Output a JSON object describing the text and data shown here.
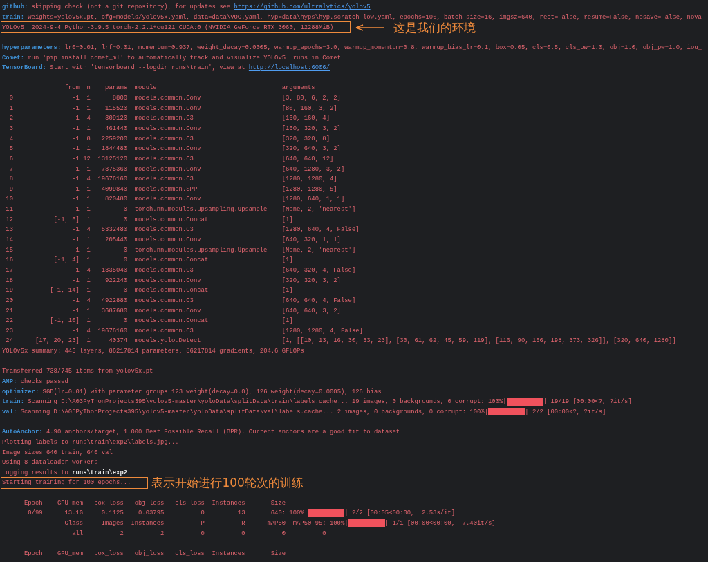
{
  "lines": [
    {
      "kind": "log",
      "segments": [
        {
          "kind": "label",
          "text": "github:"
        },
        {
          "kind": "text",
          "text": "skipping check (not a git repository), for updates see "
        },
        {
          "kind": "link",
          "text": "https://github.com/ultralytics/yolov5"
        }
      ]
    },
    {
      "kind": "log",
      "segments": [
        {
          "kind": "label",
          "text": "train:"
        },
        {
          "kind": "text",
          "text": "weights=yolov5x.pt, cfg=models/yolov5x.yaml, data=data\\VOC.yaml, hyp=data\\hyps\\hyp.scratch-low.yaml, epochs=100, batch_size=16, imgsz=640, rect=False, resume=False, nosave=False, nova"
        }
      ]
    },
    {
      "kind": "log",
      "boxed": true,
      "note": {
        "text": "这是我们的环境",
        "arrow": true
      },
      "segments": [
        {
          "kind": "text",
          "text": "YOLOv5  2024-9-4 Python-3.9.5 torch-2.2.1+cu121 CUDA:0 (NVIDIA GeForce RTX 3060, 12288MiB)"
        }
      ]
    },
    {
      "kind": "blank"
    },
    {
      "kind": "log",
      "segments": [
        {
          "kind": "label",
          "text": "hyperparameters:"
        },
        {
          "kind": "text",
          "text": "lr0=0.01, lrf=0.01, momentum=0.937, weight_decay=0.0005, warmup_epochs=3.0, warmup_momentum=0.8, warmup_bias_lr=0.1, box=0.05, cls=0.5, cls_pw=1.0, obj=1.0, obj_pw=1.0, iou_"
        }
      ]
    },
    {
      "kind": "log",
      "segments": [
        {
          "kind": "label",
          "text": "Comet:"
        },
        {
          "kind": "text",
          "text": "run 'pip install comet_ml' to automatically track and visualize YOLOv5  runs in Comet"
        }
      ]
    },
    {
      "kind": "log",
      "segments": [
        {
          "kind": "label",
          "text": "TensorBoard:"
        },
        {
          "kind": "text",
          "text": "Start with 'tensorboard --logdir runs\\train', view at "
        },
        {
          "kind": "link",
          "text": "http://localhost:6006/"
        }
      ]
    },
    {
      "kind": "blank"
    }
  ],
  "model_table": {
    "columns": [
      "",
      "from",
      "n",
      "params",
      "module",
      "arguments"
    ],
    "rows": [
      {
        "cells": [
          "0",
          "-1",
          "1",
          "8800",
          "models.common.Conv",
          "[3, 80, 6, 2, 2]"
        ]
      },
      {
        "cells": [
          "1",
          "-1",
          "1",
          "115520",
          "models.common.Conv",
          "[80, 160, 3, 2]"
        ]
      },
      {
        "cells": [
          "2",
          "-1",
          "4",
          "309120",
          "models.common.C3",
          "[160, 160, 4]"
        ]
      },
      {
        "cells": [
          "3",
          "-1",
          "1",
          "461440",
          "models.common.Conv",
          "[160, 320, 3, 2]"
        ]
      },
      {
        "cells": [
          "4",
          "-1",
          "8",
          "2259200",
          "models.common.C3",
          "[320, 320, 8]"
        ]
      },
      {
        "cells": [
          "5",
          "-1",
          "1",
          "1844480",
          "models.common.Conv",
          "[320, 640, 3, 2]"
        ]
      },
      {
        "cells": [
          "6",
          "-1",
          "12",
          "13125120",
          "models.common.C3",
          "[640, 640, 12]"
        ]
      },
      {
        "cells": [
          "7",
          "-1",
          "1",
          "7375360",
          "models.common.Conv",
          "[640, 1280, 3, 2]"
        ]
      },
      {
        "cells": [
          "8",
          "-1",
          "4",
          "19676160",
          "models.common.C3",
          "[1280, 1280, 4]"
        ]
      },
      {
        "cells": [
          "9",
          "-1",
          "1",
          "4099840",
          "models.common.SPPF",
          "[1280, 1280, 5]"
        ]
      },
      {
        "cells": [
          "10",
          "-1",
          "1",
          "820480",
          "models.common.Conv",
          "[1280, 640, 1, 1]"
        ]
      },
      {
        "cells": [
          "11",
          "-1",
          "1",
          "0",
          "torch.nn.modules.upsampling.Upsample",
          "[None, 2, 'nearest']"
        ]
      },
      {
        "cells": [
          "12",
          "[-1, 6]",
          "1",
          "0",
          "models.common.Concat",
          "[1]"
        ]
      },
      {
        "cells": [
          "13",
          "-1",
          "4",
          "5332480",
          "models.common.C3",
          "[1280, 640, 4, False]"
        ]
      },
      {
        "cells": [
          "14",
          "-1",
          "1",
          "205440",
          "models.common.Conv",
          "[640, 320, 1, 1]"
        ]
      },
      {
        "cells": [
          "15",
          "-1",
          "1",
          "0",
          "torch.nn.modules.upsampling.Upsample",
          "[None, 2, 'nearest']"
        ]
      },
      {
        "cells": [
          "16",
          "[-1, 4]",
          "1",
          "0",
          "models.common.Concat",
          "[1]"
        ]
      },
      {
        "cells": [
          "17",
          "-1",
          "4",
          "1335040",
          "models.common.C3",
          "[640, 320, 4, False]"
        ]
      },
      {
        "cells": [
          "18",
          "-1",
          "1",
          "922240",
          "models.common.Conv",
          "[320, 320, 3, 2]"
        ]
      },
      {
        "cells": [
          "19",
          "[-1, 14]",
          "1",
          "0",
          "models.common.Concat",
          "[1]"
        ]
      },
      {
        "cells": [
          "20",
          "-1",
          "4",
          "4922880",
          "models.common.C3",
          "[640, 640, 4, False]"
        ]
      },
      {
        "cells": [
          "21",
          "-1",
          "1",
          "3687680",
          "models.common.Conv",
          "[640, 640, 3, 2]"
        ]
      },
      {
        "cells": [
          "22",
          "[-1, 10]",
          "1",
          "0",
          "models.common.Concat",
          "[1]"
        ]
      },
      {
        "cells": [
          "23",
          "-1",
          "4",
          "19676160",
          "models.common.C3",
          "[1280, 1280, 4, False]"
        ]
      },
      {
        "cells": [
          "24",
          "[17, 20, 23]",
          "1",
          "40374",
          "models.yolo.Detect",
          "[1, [[10, 13, 16, 30, 33, 23], [30, 61, 62, 45, 59, 119], [116, 90, 156, 198, 373, 326]], [320, 640, 1280]]"
        ]
      }
    ]
  },
  "lines_after": [
    {
      "kind": "log",
      "segments": [
        {
          "kind": "text",
          "text": "YOLOv5x summary: 445 layers, 86217814 parameters, 86217814 gradients, 204.6 GFLOPs"
        }
      ]
    },
    {
      "kind": "blank"
    },
    {
      "kind": "log",
      "segments": [
        {
          "kind": "text",
          "text": "Transferred 738/745 items from yolov5x.pt"
        }
      ]
    },
    {
      "kind": "log",
      "segments": [
        {
          "kind": "label",
          "text": "AMP:"
        },
        {
          "kind": "text",
          "text": "checks passed"
        }
      ]
    },
    {
      "kind": "log",
      "segments": [
        {
          "kind": "label",
          "text": "optimizer:"
        },
        {
          "kind": "text",
          "text": "SGD(lr=0.01) with parameter groups 123 weight(decay=0.0), 126 weight(decay=0.0005), 126 bias"
        }
      ]
    },
    {
      "kind": "log",
      "segments": [
        {
          "kind": "label",
          "text": "train:"
        },
        {
          "kind": "text",
          "text": "Scanning D:\\A03PyThonProjects395\\yolov5-master\\yoloData\\splitData\\train\\labels.cache... 19 images, 0 backgrounds, 0 corrupt: 100%|"
        },
        {
          "kind": "bar",
          "level": 1
        },
        {
          "kind": "text",
          "text": "| 19/19 [00:00<?, ?it/s]"
        }
      ]
    },
    {
      "kind": "log",
      "segments": [
        {
          "kind": "label",
          "text": "val:"
        },
        {
          "kind": "text",
          "text": "Scanning D:\\A03PyThonProjects395\\yolov5-master\\yoloData\\splitData\\val\\labels.cache... 2 images, 0 backgrounds, 0 corrupt: 100%|"
        },
        {
          "kind": "bar",
          "level": 1
        },
        {
          "kind": "text",
          "text": "| 2/2 [00:00<?, ?it/s]"
        }
      ]
    },
    {
      "kind": "blank"
    },
    {
      "kind": "log",
      "segments": [
        {
          "kind": "label",
          "text": "AutoAnchor:"
        },
        {
          "kind": "text",
          "text": "4.90 anchors/target, 1.000 Best Possible Recall (BPR). Current anchors are a good fit to dataset"
        }
      ]
    },
    {
      "kind": "log",
      "segments": [
        {
          "kind": "text",
          "text": "Plotting labels to runs\\train\\exp2\\labels.jpg..."
        }
      ]
    },
    {
      "kind": "log",
      "segments": [
        {
          "kind": "text",
          "text": "Image sizes 640 train, 640 val"
        }
      ]
    },
    {
      "kind": "log",
      "segments": [
        {
          "kind": "text",
          "text": "Using 8 dataloader workers"
        }
      ]
    },
    {
      "kind": "log",
      "segments": [
        {
          "kind": "text",
          "text": "Logging results to "
        },
        {
          "kind": "path",
          "text": "runs\\train\\exp2"
        }
      ]
    },
    {
      "kind": "log",
      "boxed": true,
      "note": {
        "text": "表示开始进行100轮次的训练",
        "arrow": false
      },
      "segments": [
        {
          "kind": "text",
          "text": "Starting training for 100 epochs..."
        }
      ]
    },
    {
      "kind": "blank"
    }
  ],
  "epoch_table": [
    {
      "kind": "epoch",
      "cells": [
        "Epoch",
        "GPU_mem",
        "box_loss",
        "obj_loss",
        "cls_loss",
        "Instances",
        "Size"
      ]
    },
    {
      "kind": "epoch",
      "cells": [
        "0/99",
        "13.1G",
        "0.1125",
        "0.03795",
        "0",
        "13",
        "640:"
      ],
      "progress": [
        {
          "kind": "text",
          "text": "100%|"
        },
        {
          "kind": "bar",
          "level": 1
        },
        {
          "kind": "text",
          "text": "| 2/2 [00:05<00:00,  2.53s/it]"
        }
      ]
    },
    {
      "kind": "metric",
      "cells": [
        "Class",
        "Images",
        "Instances",
        "P",
        "R",
        "mAP50",
        "mAP50-95:"
      ],
      "progress": [
        {
          "kind": "text",
          "text": "100%|"
        },
        {
          "kind": "bar",
          "level": 1
        },
        {
          "kind": "text",
          "text": "| 1/1 [00:00<00:00,  7.40it/s]"
        }
      ]
    },
    {
      "kind": "metric",
      "cells": [
        "all",
        "2",
        "2",
        "0",
        "0",
        "0",
        "0"
      ]
    },
    {
      "kind": "blank"
    },
    {
      "kind": "epoch",
      "cells": [
        "Epoch",
        "GPU_mem",
        "box_loss",
        "obj_loss",
        "cls_loss",
        "Instances",
        "Size"
      ]
    }
  ]
}
